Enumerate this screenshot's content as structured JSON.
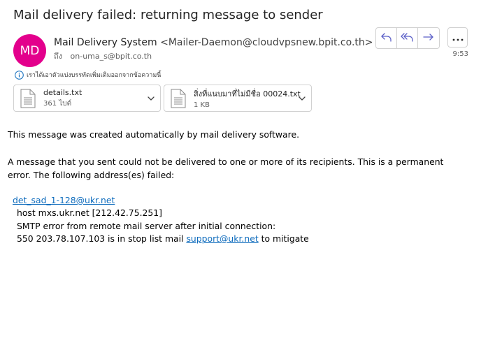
{
  "header": {
    "subject": "Mail delivery failed: returning message to sender",
    "avatar_initials": "MD",
    "avatar_color": "#e3008c",
    "sender_name": "Mail Delivery System",
    "sender_email": "<Mailer-Daemon@cloudvpsnew.bpit.co.th>",
    "to_label": "ถึง",
    "to_address": "on-uma_s@bpit.co.th",
    "time": "9:53"
  },
  "actions": {
    "reply_icon": "reply-icon",
    "reply_all_icon": "reply-all-icon",
    "forward_icon": "forward-icon",
    "more_icon": "more-icon",
    "accent_color": "#5b5fc7"
  },
  "info_bar": {
    "text": "เราได้เอาตัวแบ่งบรรทัดเพิ่มเติมออกจากข้อความนี้"
  },
  "attachments": [
    {
      "name": "details.txt",
      "size": "361 ไบต์"
    },
    {
      "name": "สิ่งที่แนบมาที่ไม่มีชื่อ 00024.txt",
      "size": "1 KB"
    }
  ],
  "body": {
    "line1": "This message was created automatically by mail delivery software.",
    "line2": "A message that you sent could not be delivered to one or more of its recipients. This is a permanent error. The following address(es) failed:",
    "failed_address": "det_sad_1-128@ukr.net",
    "host_line": "host mxs.ukr.net [212.42.75.251]",
    "smtp_line": "SMTP error from remote mail server after initial connection:",
    "error_prefix": "550 203.78.107.103 is in stop list mail",
    "support_link": "support@ukr.net",
    "error_suffix": "to mitigate"
  }
}
